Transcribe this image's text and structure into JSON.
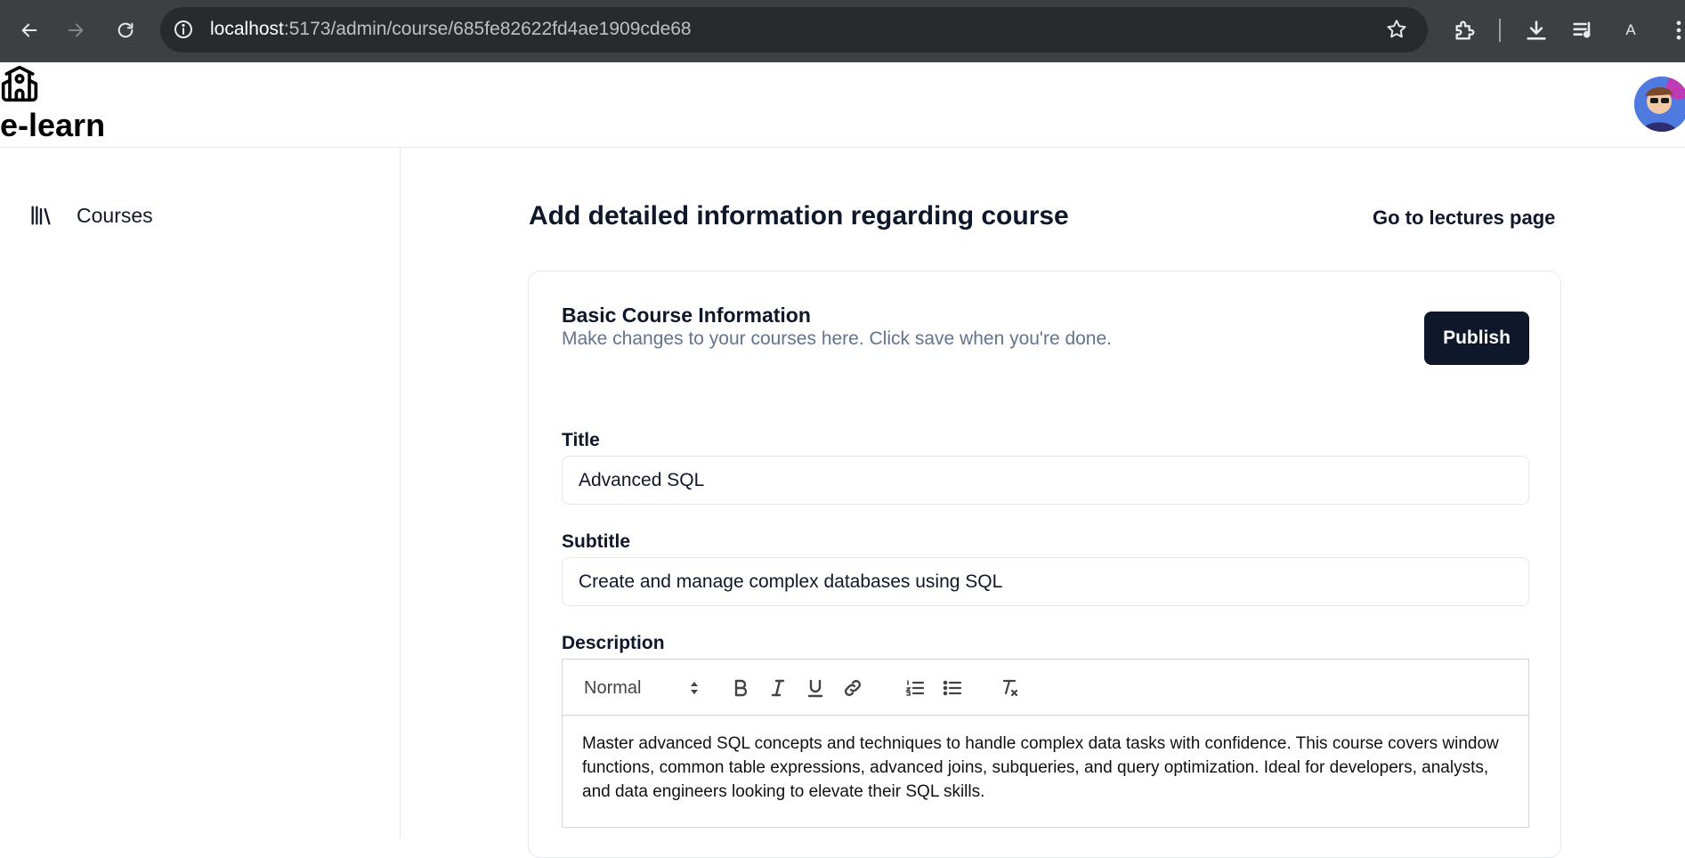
{
  "browser": {
    "url_host": "localhost",
    "url_path": ":5173/admin/course/685fe82622fd4ae1909cde68",
    "profile_initial": "A"
  },
  "app": {
    "brand": "e-learn"
  },
  "sidebar": {
    "items": [
      {
        "label": "Courses",
        "icon": "library-icon"
      }
    ]
  },
  "main": {
    "title": "Add detailed information regarding course",
    "lectures_link": "Go to lectures page"
  },
  "card": {
    "title": "Basic Course Information",
    "description": "Make changes to your courses here. Click save when you're done.",
    "publish_label": "Publish",
    "fields": {
      "title_label": "Title",
      "title_value": "Advanced SQL",
      "subtitle_label": "Subtitle",
      "subtitle_value": "Create and manage complex databases using SQL",
      "description_label": "Description"
    },
    "editor": {
      "format": "Normal",
      "content": "Master advanced SQL concepts and techniques to handle complex data tasks with confidence. This course covers window functions, common table expressions, advanced joins, subqueries, and query optimization. Ideal for developers, analysts, and data engineers looking to elevate their SQL skills."
    }
  },
  "colors": {
    "chrome_bg": "#3c4043",
    "omnibox_bg": "#282a2d",
    "primary_button": "#0f172a",
    "muted_text": "#64748b",
    "border": "#e5e7eb"
  }
}
